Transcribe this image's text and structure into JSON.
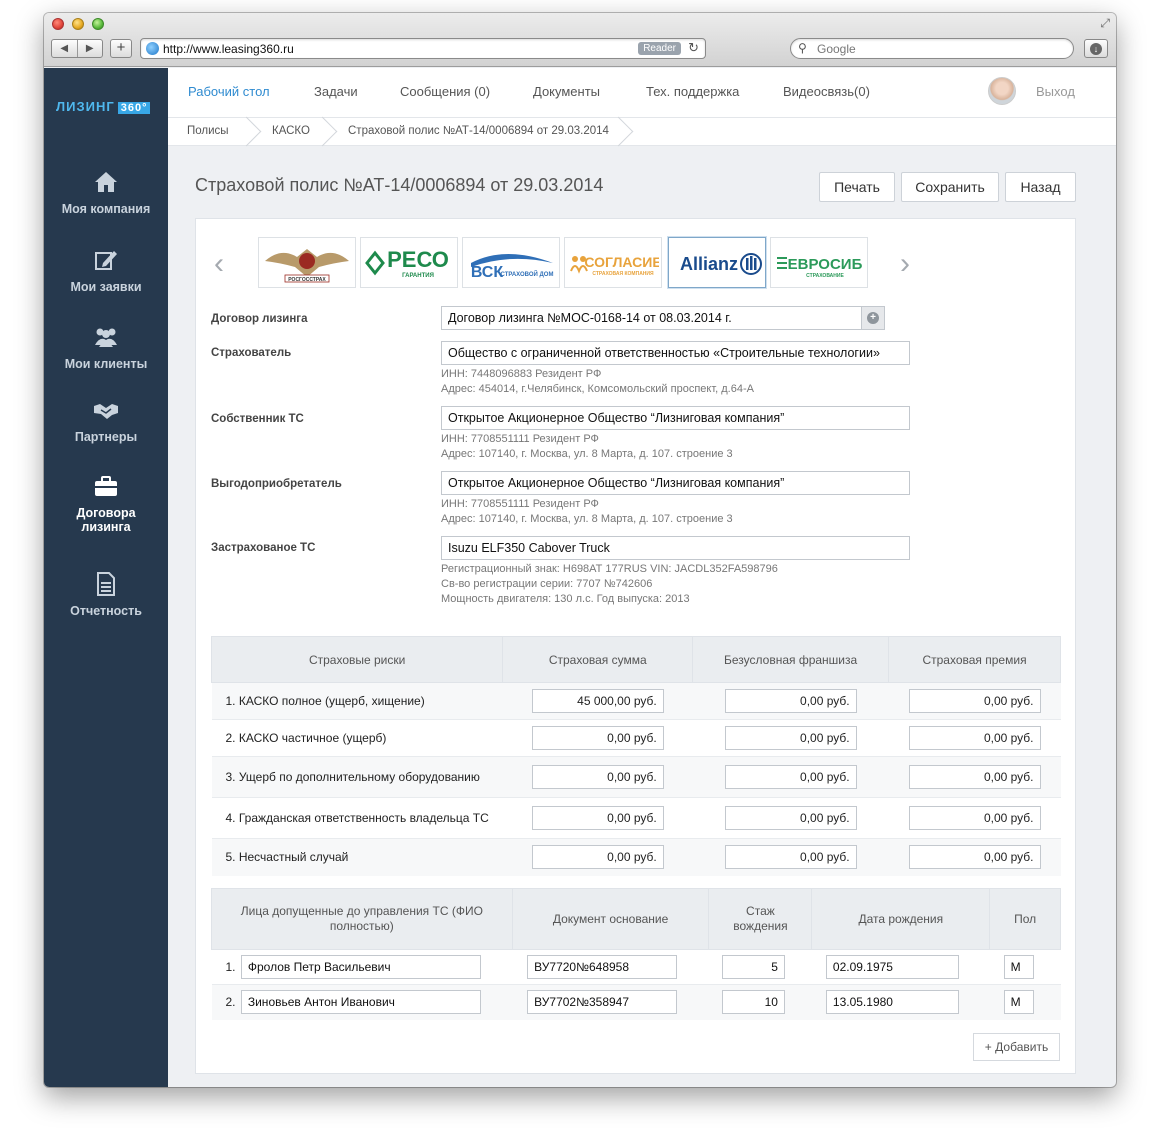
{
  "browser": {
    "url": "http://www.leasing360.ru",
    "reader_label": "Reader",
    "search_placeholder": "Google"
  },
  "brand": {
    "name": "ЛИЗИНГ",
    "badge": "360°"
  },
  "sidebar": {
    "items": [
      {
        "label": "Моя компания",
        "icon": "home-icon"
      },
      {
        "label": "Мои заявки",
        "icon": "edit-icon"
      },
      {
        "label": "Мои клиенты",
        "icon": "users-icon"
      },
      {
        "label": "Партнеры",
        "icon": "handshake-icon"
      },
      {
        "label": "Договора лизинга",
        "icon": "briefcase-icon",
        "active": true
      },
      {
        "label": "Отчетность",
        "icon": "document-icon"
      }
    ]
  },
  "topnav": {
    "items": [
      "Рабочий стол",
      "Задачи",
      "Сообщения (0)",
      "Документы",
      "Тех. поддержка",
      "Видеосвязь(0)"
    ],
    "logout": "Выход"
  },
  "breadcrumbs": [
    "Полисы",
    "КАСКО",
    "Страховой полис №АТ-14/0006894 от 29.03.2014"
  ],
  "page": {
    "title": "Страховой полис №АТ-14/0006894 от 29.03.2014",
    "buttons": {
      "print": "Печать",
      "save": "Сохранить",
      "back": "Назад"
    }
  },
  "insurers": {
    "items": [
      "РОСГОССТРАХ",
      "РЕСО ГАРАНТИЯ",
      "ВСК СТРАХОВОЙ ДОМ",
      "СОГЛАСИЕ",
      "Allianz",
      "ЕВРОСИБ СТРАХОВАНИЕ"
    ],
    "selected": "Allianz"
  },
  "form": {
    "lease_label": "Договор лизинга",
    "lease_value": "Договор лизинга №МОС-0168-14 от 08.03.2014 г.",
    "insurer_label": "Страхователь",
    "insurer_value": "Общество с ограниченной ответственностью «Строительные технологии»",
    "insurer_inn": "ИНН: 7448096883 Резидент РФ",
    "insurer_addr": "Адрес: 454014, г.Челябинск, Комсомольский проспект, д.64-А",
    "owner_label": "Собственник ТС",
    "owner_value": "Открытое Акционерное Общество “Лизниговая компания”",
    "owner_inn": "ИНН: 7708551111 Резидент РФ",
    "owner_addr": "Адрес: 107140, г. Москва,  ул. 8 Марта, д. 107. строение 3",
    "benef_label": "Выгодоприобретатель",
    "benef_value": "Открытое Акционерное Общество “Лизниговая компания”",
    "benef_inn": "ИНН: 7708551111 Резидент РФ",
    "benef_addr": "Адрес: 107140, г. Москва,  ул. 8 Марта, д. 107. строение 3",
    "vehicle_label": "Застрахованое ТС",
    "vehicle_value": "Isuzu ELF350 Cabover Truck",
    "vehicle_reg": "Регистрационный знак: Н698АТ 177RUS VIN: JACDL352FA598796",
    "vehicle_cert": "Св-во регистрации серии: 7707 №742606",
    "vehicle_power": "Мощность двигателя: 130 л.с. Год выпуска: 2013"
  },
  "risks": {
    "headers": [
      "Страховые риски",
      "Страховая сумма",
      "Безусловная франшиза",
      "Страховая премия"
    ],
    "rows": [
      {
        "name": "1. КАСКО полное (ущерб, хищение)",
        "sum": "45 000,00 руб.",
        "deductible": "0,00 руб.",
        "premium": "0,00 руб."
      },
      {
        "name": "2. КАСКО частичное (ущерб)",
        "sum": "0,00 руб.",
        "deductible": "0,00 руб.",
        "premium": "0,00 руб."
      },
      {
        "name": "3. Ущерб по дополнительному оборудованию",
        "sum": "0,00 руб.",
        "deductible": "0,00 руб.",
        "premium": "0,00 руб."
      },
      {
        "name": "4. Гражданская ответственность владельца ТС",
        "sum": "0,00 руб.",
        "deductible": "0,00 руб.",
        "premium": "0,00 руб."
      },
      {
        "name": "5. Несчастный случай",
        "sum": "0,00 руб.",
        "deductible": "0,00 руб.",
        "premium": "0,00 руб."
      }
    ]
  },
  "drivers": {
    "headers": [
      "Лица допущенные до управления ТС (ФИО полностью)",
      "Документ основание",
      "Стаж вождения",
      "Дата рождения",
      "Пол"
    ],
    "rows": [
      {
        "num": "1.",
        "name": "Фролов Петр Васильевич",
        "doc": "ВУ7720№648958",
        "exp": "5",
        "dob": "02.09.1975",
        "sex": "М"
      },
      {
        "num": "2.",
        "name": "Зиновьев Антон Иванович",
        "doc": "ВУ7702№358947",
        "exp": "10",
        "dob": "13.05.1980",
        "sex": "М"
      }
    ],
    "add_label": "Добавить"
  }
}
